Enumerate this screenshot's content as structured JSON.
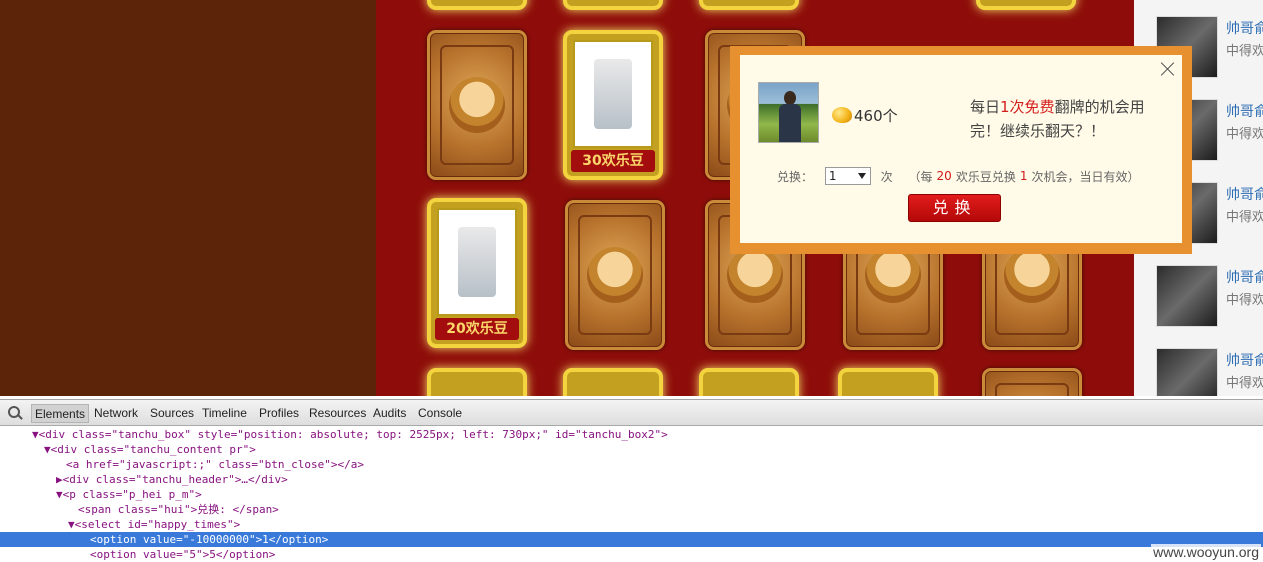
{
  "popup": {
    "bean_count": "460个",
    "msg_prefix": "每日",
    "msg_highlight": "1次免费",
    "msg_suffix": "翻牌的机会用完！继续乐翻天？！",
    "exchange_label": "兑换：",
    "select_value": "1",
    "unit": "次",
    "rule_open": "（每",
    "rule_cost": "20",
    "rule_mid": "欢乐豆兑换",
    "rule_count": "1",
    "rule_close": "次机会，当日有效）",
    "button_label": "兑换"
  },
  "cards": {
    "prize_1": "30欢乐豆",
    "prize_2": "20欢乐豆"
  },
  "side_list": {
    "name": "帅哥俞",
    "desc": "中得欢"
  },
  "devtools": {
    "tabs": [
      "Elements",
      "Network",
      "Sources",
      "Timeline",
      "Profiles",
      "Resources",
      "Audits",
      "Console"
    ],
    "active_tab": "Elements",
    "dom_lines": [
      "▼<div class=\"tanchu_box\" style=\"position: absolute; top: 2525px; left: 730px;\" id=\"tanchu_box2\">",
      "▼<div class=\"tanchu_content pr\">",
      "<a href=\"javascript:;\" class=\"btn_close\"></a>",
      "▶<div class=\"tanchu_header\">…</div>",
      "▼<p class=\"p_hei p_m\">",
      "<span class=\"hui\">兑换: </span>",
      "▼<select id=\"happy_times\">",
      "<option value=\"-10000000\">1</option>",
      "<option value=\"5\">5</option>"
    ]
  },
  "watermark": "www.wooyun.org"
}
